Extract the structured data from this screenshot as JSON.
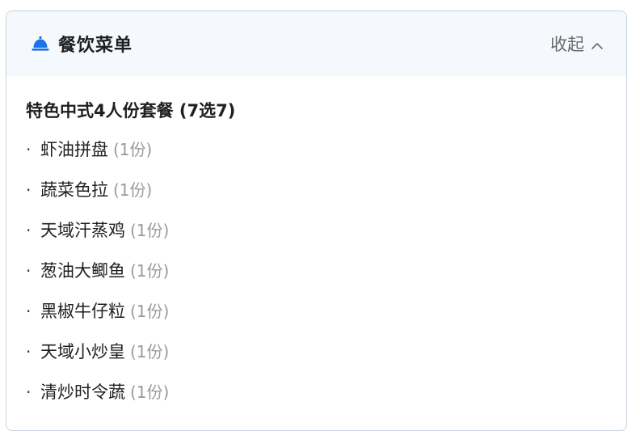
{
  "header": {
    "icon": "service-bell-icon",
    "title": "餐饮菜单",
    "collapse_label": "收起",
    "collapse_icon": "chevron-up-icon",
    "accent_color": "#1a73e8"
  },
  "menu": {
    "set_title": "特色中式4人份套餐 (7选7)",
    "items": [
      {
        "name": "虾油拼盘",
        "qty": "(1份)"
      },
      {
        "name": "蔬菜色拉",
        "qty": "(1份)"
      },
      {
        "name": "天域汗蒸鸡",
        "qty": "(1份)"
      },
      {
        "name": "葱油大鲫鱼",
        "qty": "(1份)"
      },
      {
        "name": "黑椒牛仔粒",
        "qty": "(1份)"
      },
      {
        "name": "天域小炒皇",
        "qty": "(1份)"
      },
      {
        "name": "清炒时令蔬",
        "qty": "(1份)"
      }
    ]
  }
}
